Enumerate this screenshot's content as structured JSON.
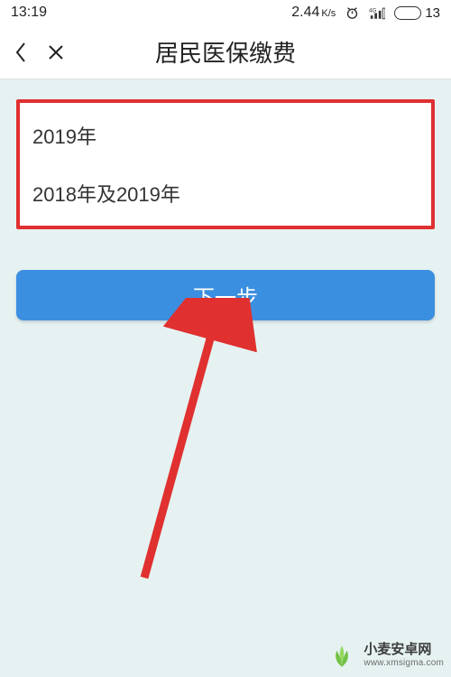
{
  "status": {
    "time": "13:19",
    "speed_value": "2.44",
    "speed_unit": "K/s",
    "battery_pct": "13"
  },
  "nav": {
    "title": "居民医保缴费"
  },
  "options": [
    {
      "label": "2019年"
    },
    {
      "label": "2018年及2019年"
    }
  ],
  "actions": {
    "next_label": "下一步"
  },
  "watermark": {
    "name_cn": "小麦安卓网",
    "name_en": "www.xmsigma.com"
  }
}
